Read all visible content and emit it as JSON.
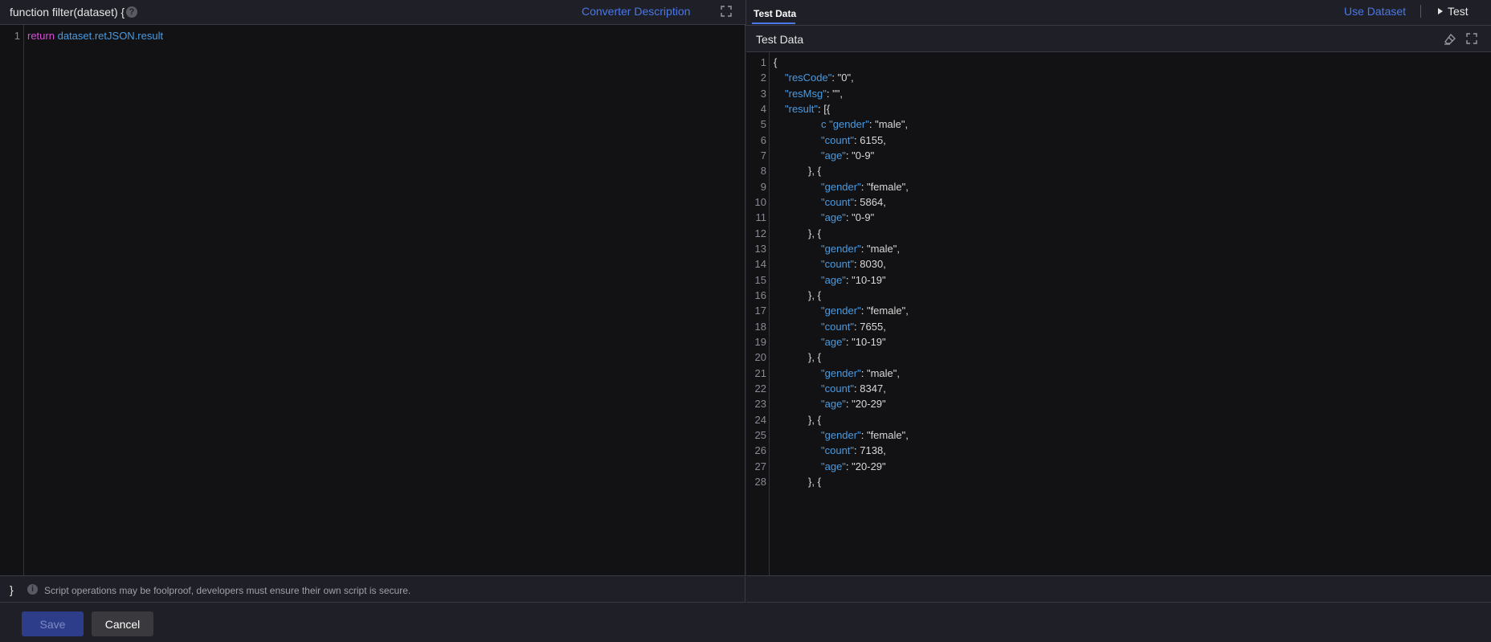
{
  "converter": {
    "title": "function filter(dataset) {",
    "help_icon": "question-circle-icon",
    "description_link": "Converter Description",
    "code": {
      "line_number": "1",
      "keyword": "return",
      "expression": "dataset.retJSON.result"
    },
    "closing_brace": "}",
    "warning_icon": "info-circle-icon",
    "warning": "Script operations may be foolproof, developers must ensure their own script is secure."
  },
  "test_panel": {
    "tab_label": "Test Data",
    "use_dataset": "Use Dataset",
    "test_button": "Test",
    "header_title": "Test Data",
    "lines": [
      "{",
      "  \"resCode\": \"0\",",
      "  \"resMsg\": \"\",",
      "  \"result\": [{",
      "c \"gender\": \"male\",",
      "\"count\": 6155,",
      "\"age\": \"0-9\"",
      "}, {",
      "\"gender\": \"female\",",
      "\"count\": 5864,",
      "\"age\": \"0-9\"",
      "}, {",
      "\"gender\": \"male\",",
      "\"count\": 8030,",
      "\"age\": \"10-19\"",
      "}, {",
      "\"gender\": \"female\",",
      "\"count\": 7655,",
      "\"age\": \"10-19\"",
      "}, {",
      "\"gender\": \"male\",",
      "\"count\": 8347,",
      "\"age\": \"20-29\"",
      "}, {",
      "\"gender\": \"female\",",
      "\"count\": 7138,",
      "\"age\": \"20-29\"",
      "}, {"
    ]
  },
  "buttons": {
    "save": "Save",
    "cancel": "Cancel"
  },
  "colors": {
    "accent": "#4a78e8",
    "json_key": "#4a9be0",
    "json_number": "#5aab4a",
    "keyword": "#d64fd6"
  }
}
